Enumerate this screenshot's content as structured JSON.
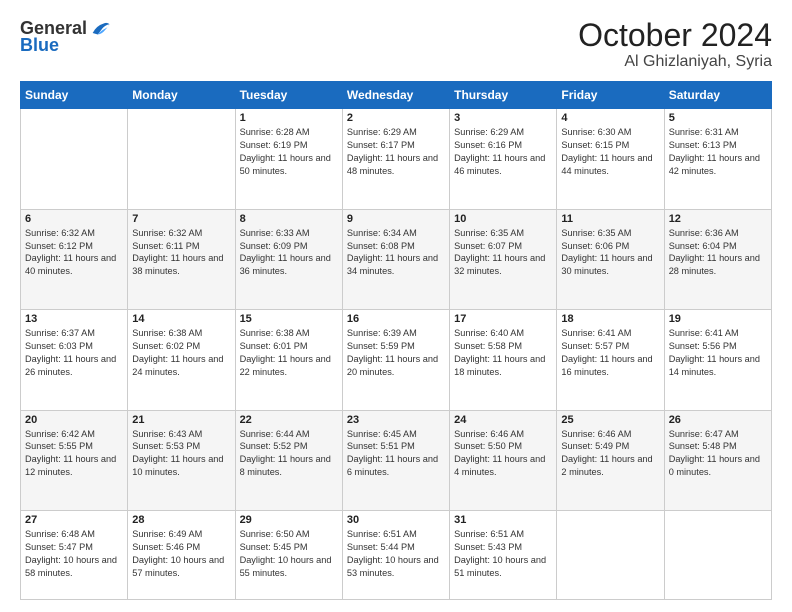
{
  "header": {
    "logo_general": "General",
    "logo_blue": "Blue",
    "month": "October 2024",
    "location": "Al Ghizlaniyah, Syria"
  },
  "days_of_week": [
    "Sunday",
    "Monday",
    "Tuesday",
    "Wednesday",
    "Thursday",
    "Friday",
    "Saturday"
  ],
  "weeks": [
    [
      {
        "day": "",
        "sunrise": "",
        "sunset": "",
        "daylight": ""
      },
      {
        "day": "",
        "sunrise": "",
        "sunset": "",
        "daylight": ""
      },
      {
        "day": "1",
        "sunrise": "Sunrise: 6:28 AM",
        "sunset": "Sunset: 6:19 PM",
        "daylight": "Daylight: 11 hours and 50 minutes."
      },
      {
        "day": "2",
        "sunrise": "Sunrise: 6:29 AM",
        "sunset": "Sunset: 6:17 PM",
        "daylight": "Daylight: 11 hours and 48 minutes."
      },
      {
        "day": "3",
        "sunrise": "Sunrise: 6:29 AM",
        "sunset": "Sunset: 6:16 PM",
        "daylight": "Daylight: 11 hours and 46 minutes."
      },
      {
        "day": "4",
        "sunrise": "Sunrise: 6:30 AM",
        "sunset": "Sunset: 6:15 PM",
        "daylight": "Daylight: 11 hours and 44 minutes."
      },
      {
        "day": "5",
        "sunrise": "Sunrise: 6:31 AM",
        "sunset": "Sunset: 6:13 PM",
        "daylight": "Daylight: 11 hours and 42 minutes."
      }
    ],
    [
      {
        "day": "6",
        "sunrise": "Sunrise: 6:32 AM",
        "sunset": "Sunset: 6:12 PM",
        "daylight": "Daylight: 11 hours and 40 minutes."
      },
      {
        "day": "7",
        "sunrise": "Sunrise: 6:32 AM",
        "sunset": "Sunset: 6:11 PM",
        "daylight": "Daylight: 11 hours and 38 minutes."
      },
      {
        "day": "8",
        "sunrise": "Sunrise: 6:33 AM",
        "sunset": "Sunset: 6:09 PM",
        "daylight": "Daylight: 11 hours and 36 minutes."
      },
      {
        "day": "9",
        "sunrise": "Sunrise: 6:34 AM",
        "sunset": "Sunset: 6:08 PM",
        "daylight": "Daylight: 11 hours and 34 minutes."
      },
      {
        "day": "10",
        "sunrise": "Sunrise: 6:35 AM",
        "sunset": "Sunset: 6:07 PM",
        "daylight": "Daylight: 11 hours and 32 minutes."
      },
      {
        "day": "11",
        "sunrise": "Sunrise: 6:35 AM",
        "sunset": "Sunset: 6:06 PM",
        "daylight": "Daylight: 11 hours and 30 minutes."
      },
      {
        "day": "12",
        "sunrise": "Sunrise: 6:36 AM",
        "sunset": "Sunset: 6:04 PM",
        "daylight": "Daylight: 11 hours and 28 minutes."
      }
    ],
    [
      {
        "day": "13",
        "sunrise": "Sunrise: 6:37 AM",
        "sunset": "Sunset: 6:03 PM",
        "daylight": "Daylight: 11 hours and 26 minutes."
      },
      {
        "day": "14",
        "sunrise": "Sunrise: 6:38 AM",
        "sunset": "Sunset: 6:02 PM",
        "daylight": "Daylight: 11 hours and 24 minutes."
      },
      {
        "day": "15",
        "sunrise": "Sunrise: 6:38 AM",
        "sunset": "Sunset: 6:01 PM",
        "daylight": "Daylight: 11 hours and 22 minutes."
      },
      {
        "day": "16",
        "sunrise": "Sunrise: 6:39 AM",
        "sunset": "Sunset: 5:59 PM",
        "daylight": "Daylight: 11 hours and 20 minutes."
      },
      {
        "day": "17",
        "sunrise": "Sunrise: 6:40 AM",
        "sunset": "Sunset: 5:58 PM",
        "daylight": "Daylight: 11 hours and 18 minutes."
      },
      {
        "day": "18",
        "sunrise": "Sunrise: 6:41 AM",
        "sunset": "Sunset: 5:57 PM",
        "daylight": "Daylight: 11 hours and 16 minutes."
      },
      {
        "day": "19",
        "sunrise": "Sunrise: 6:41 AM",
        "sunset": "Sunset: 5:56 PM",
        "daylight": "Daylight: 11 hours and 14 minutes."
      }
    ],
    [
      {
        "day": "20",
        "sunrise": "Sunrise: 6:42 AM",
        "sunset": "Sunset: 5:55 PM",
        "daylight": "Daylight: 11 hours and 12 minutes."
      },
      {
        "day": "21",
        "sunrise": "Sunrise: 6:43 AM",
        "sunset": "Sunset: 5:53 PM",
        "daylight": "Daylight: 11 hours and 10 minutes."
      },
      {
        "day": "22",
        "sunrise": "Sunrise: 6:44 AM",
        "sunset": "Sunset: 5:52 PM",
        "daylight": "Daylight: 11 hours and 8 minutes."
      },
      {
        "day": "23",
        "sunrise": "Sunrise: 6:45 AM",
        "sunset": "Sunset: 5:51 PM",
        "daylight": "Daylight: 11 hours and 6 minutes."
      },
      {
        "day": "24",
        "sunrise": "Sunrise: 6:46 AM",
        "sunset": "Sunset: 5:50 PM",
        "daylight": "Daylight: 11 hours and 4 minutes."
      },
      {
        "day": "25",
        "sunrise": "Sunrise: 6:46 AM",
        "sunset": "Sunset: 5:49 PM",
        "daylight": "Daylight: 11 hours and 2 minutes."
      },
      {
        "day": "26",
        "sunrise": "Sunrise: 6:47 AM",
        "sunset": "Sunset: 5:48 PM",
        "daylight": "Daylight: 11 hours and 0 minutes."
      }
    ],
    [
      {
        "day": "27",
        "sunrise": "Sunrise: 6:48 AM",
        "sunset": "Sunset: 5:47 PM",
        "daylight": "Daylight: 10 hours and 58 minutes."
      },
      {
        "day": "28",
        "sunrise": "Sunrise: 6:49 AM",
        "sunset": "Sunset: 5:46 PM",
        "daylight": "Daylight: 10 hours and 57 minutes."
      },
      {
        "day": "29",
        "sunrise": "Sunrise: 6:50 AM",
        "sunset": "Sunset: 5:45 PM",
        "daylight": "Daylight: 10 hours and 55 minutes."
      },
      {
        "day": "30",
        "sunrise": "Sunrise: 6:51 AM",
        "sunset": "Sunset: 5:44 PM",
        "daylight": "Daylight: 10 hours and 53 minutes."
      },
      {
        "day": "31",
        "sunrise": "Sunrise: 6:51 AM",
        "sunset": "Sunset: 5:43 PM",
        "daylight": "Daylight: 10 hours and 51 minutes."
      },
      {
        "day": "",
        "sunrise": "",
        "sunset": "",
        "daylight": ""
      },
      {
        "day": "",
        "sunrise": "",
        "sunset": "",
        "daylight": ""
      }
    ]
  ]
}
